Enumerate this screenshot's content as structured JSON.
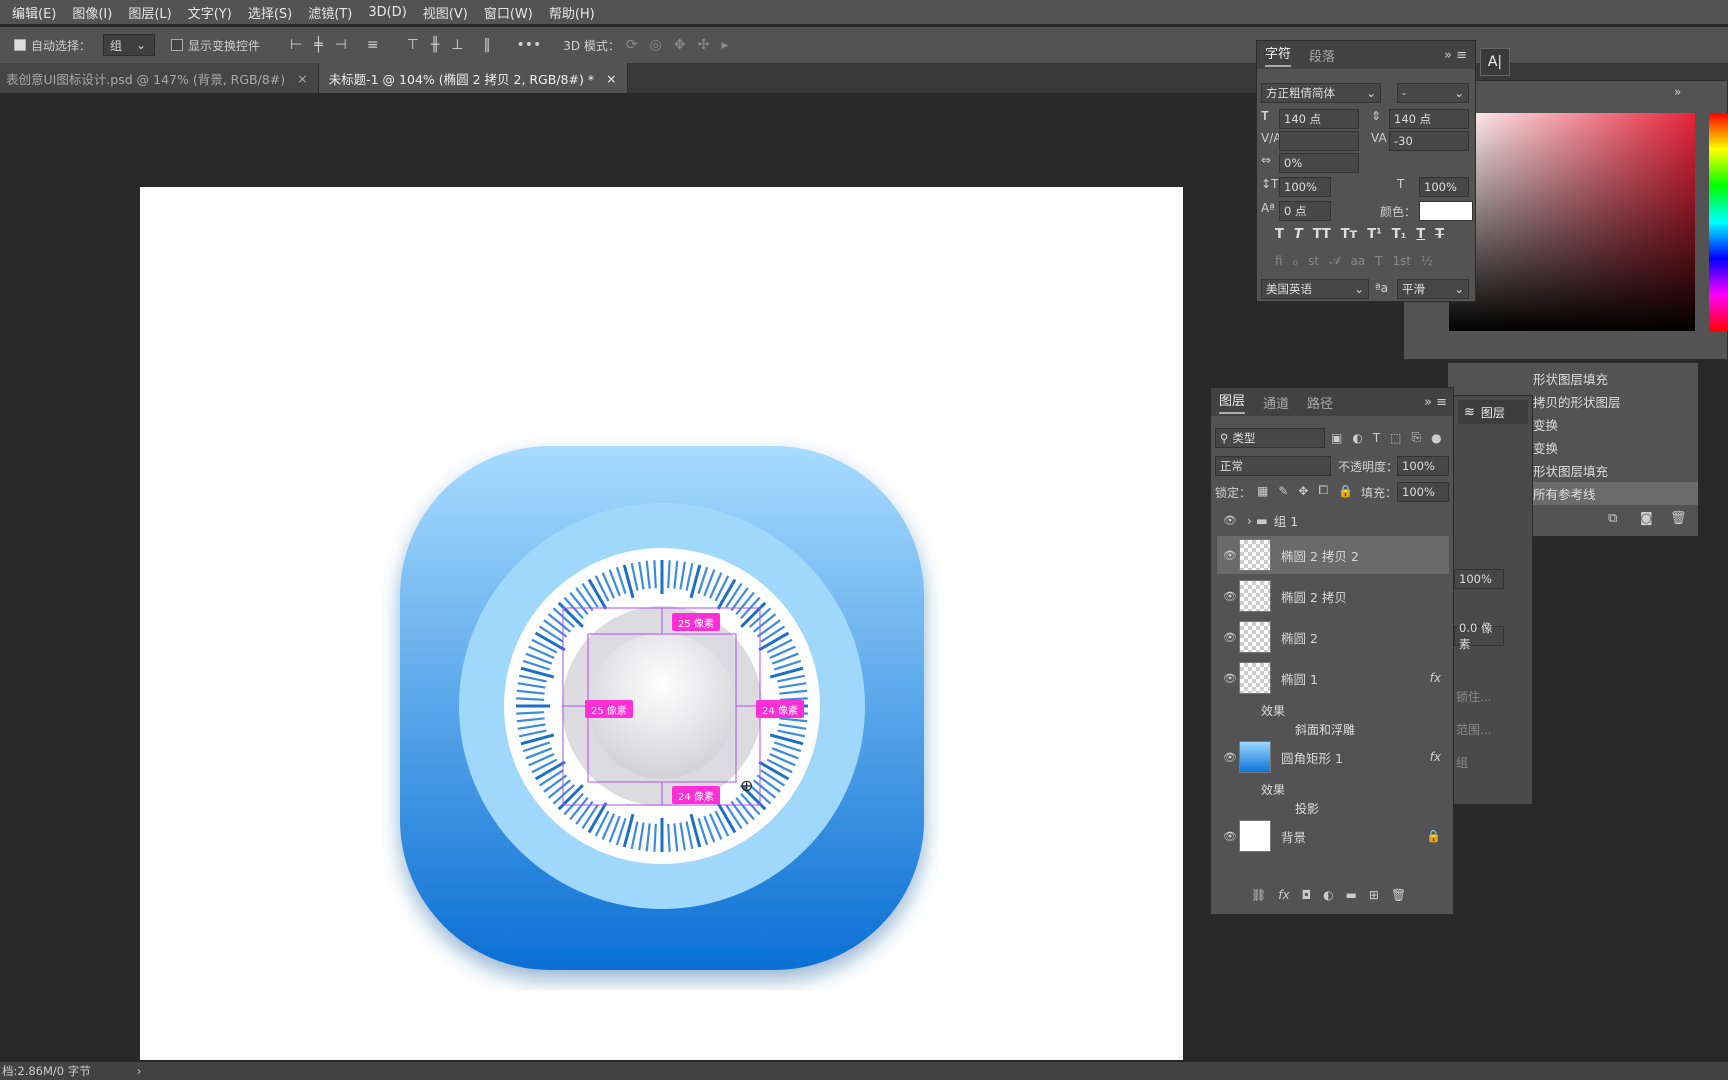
{
  "menu": [
    "编辑(E)",
    "图像(I)",
    "图层(L)",
    "文字(Y)",
    "选择(S)",
    "滤镜(T)",
    "3D(D)",
    "视图(V)",
    "窗口(W)",
    "帮助(H)"
  ],
  "options": {
    "auto_select_label": "自动选择：",
    "auto_select_value": "组",
    "show_transform_label": "显示变换控件",
    "more": "•••",
    "mode3d": "3D 模式："
  },
  "tabs": [
    {
      "label": "表创意UI图标设计.psd @ 147% (背景, RGB/8#)",
      "close": "×"
    },
    {
      "label": "未标题-1 @ 104% (椭圆 2 拷贝 2, RGB/8#) *",
      "close": "×"
    }
  ],
  "measure": {
    "top": "25 像素",
    "left": "25 像素",
    "right": "24 像素",
    "bottom": "24 像素"
  },
  "character": {
    "tabs": [
      "字符",
      "段落"
    ],
    "font": "方正粗倩简体",
    "style": "-",
    "size": "140 点",
    "leading": "140 点",
    "kerning": "",
    "tracking": "-30",
    "scale_pct": "0%",
    "vscale": "100%",
    "hscale": "100%",
    "baseline": "0 点",
    "color_label": "颜色：",
    "language": "美国英语",
    "aa_label": "ªa",
    "aa": "平滑"
  },
  "layers_panel": {
    "tabs": [
      "图层",
      "通道",
      "路径"
    ],
    "filter": "类型",
    "blend": "正常",
    "opacity_label": "不透明度：",
    "opacity": "100%",
    "lock_label": "锁定：",
    "fill_label": "填充：",
    "fill": "100%",
    "layers": [
      {
        "name": "组 1"
      },
      {
        "name": "椭圆 2 拷贝 2"
      },
      {
        "name": "椭圆 2 拷贝"
      },
      {
        "name": "椭圆 2"
      },
      {
        "name": "椭圆 1",
        "fx": "fx"
      },
      {
        "name": "圆角矩形 1",
        "fx": "fx"
      },
      {
        "name": "背景"
      }
    ],
    "effects": {
      "label": "效果",
      "bevel": "斜面和浮雕",
      "shadow": "投影"
    }
  },
  "mini_layers": {
    "label": "图层",
    "pct": "100%",
    "px": "0.0 像素",
    "r1": "锁住...",
    "r2": "范围...",
    "r3": "组"
  },
  "history": [
    "形状图层填充",
    "拷贝的形状图层",
    "变换",
    "变换",
    "形状图层填充",
    "所有参考线"
  ],
  "status": {
    "text": "档:2.86M/0 字节"
  },
  "colors": {
    "accent": "#ff2fd6",
    "icon_top": "#9dd8ff",
    "icon_bottom": "#0b73d8"
  }
}
